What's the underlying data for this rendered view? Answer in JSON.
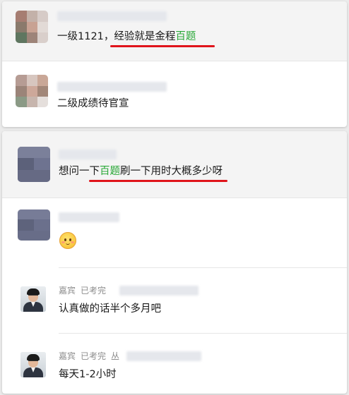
{
  "colors": {
    "highlight_green": "#2aa838",
    "underline_red": "#e0141b",
    "meta_gray": "#8d8d8d"
  },
  "post1": {
    "pre": "一级1121，",
    "mid": "经验就是金程",
    "hl": "百题"
  },
  "post2": {
    "text": "二级成绩待官宣"
  },
  "post3": {
    "pre": "想问一",
    "mid1": "下",
    "hl": "百题",
    "mid2": "刷一下用时大概多少",
    "post": "呀"
  },
  "reply1": {
    "emoji": "smiling-face-emoji"
  },
  "reply2": {
    "name": "嘉宾",
    "badge": "已考完",
    "text": "认真做的话半个多月吧"
  },
  "reply3": {
    "name": "嘉宾",
    "badge": "已考完",
    "extra": "丛",
    "text": "每天1-2小时"
  }
}
